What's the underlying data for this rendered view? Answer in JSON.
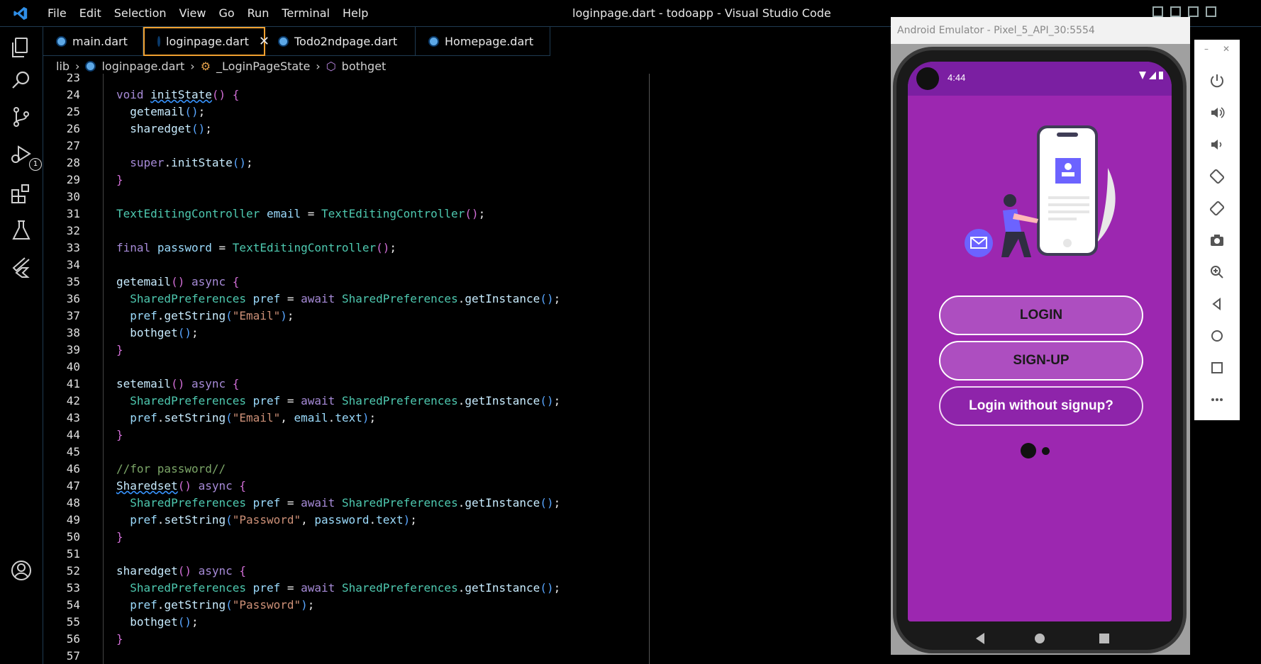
{
  "menu": [
    "File",
    "Edit",
    "Selection",
    "View",
    "Go",
    "Run",
    "Terminal",
    "Help"
  ],
  "window_title": "loginpage.dart - todoapp - Visual Studio Code",
  "tabs": [
    {
      "label": "main.dart"
    },
    {
      "label": "loginpage.dart",
      "active": true
    },
    {
      "label": "Todo2ndpage.dart"
    },
    {
      "label": "Homepage.dart"
    }
  ],
  "breadcrumb": {
    "root": "lib",
    "file": "loginpage.dart",
    "class": "_LoginPageState",
    "method": "bothget"
  },
  "debug_badge": "1",
  "code_lines": [
    {
      "n": "23",
      "html": ""
    },
    {
      "n": "24",
      "html": "<span class='kw'>void</span> <span class='fn squig'>initState</span><span class='br'>()</span> <span class='br'>{</span>"
    },
    {
      "n": "25",
      "html": "  <span class='fn'>getemail</span><span class='br2'>()</span><span class='pn'>;</span>"
    },
    {
      "n": "26",
      "html": "  <span class='fn'>sharedget</span><span class='br2'>()</span><span class='pn'>;</span>"
    },
    {
      "n": "27",
      "html": ""
    },
    {
      "n": "28",
      "html": "  <span class='kw'>super</span><span class='pn'>.</span><span class='fn'>initState</span><span class='br2'>()</span><span class='pn'>;</span>"
    },
    {
      "n": "29",
      "html": "<span class='br'>}</span>"
    },
    {
      "n": "30",
      "html": ""
    },
    {
      "n": "31",
      "html": "<span class='ty'>TextEditingController</span> <span class='var'>email</span> <span class='pn'>=</span> <span class='ty'>TextEditingController</span><span class='br'>()</span><span class='pn'>;</span>"
    },
    {
      "n": "32",
      "html": ""
    },
    {
      "n": "33",
      "html": "<span class='kw'>final</span> <span class='var'>password</span> <span class='pn'>=</span> <span class='ty'>TextEditingController</span><span class='br'>()</span><span class='pn'>;</span>"
    },
    {
      "n": "34",
      "html": ""
    },
    {
      "n": "35",
      "html": "<span class='fn'>getemail</span><span class='br'>()</span> <span class='kw'>async</span> <span class='br'>{</span>"
    },
    {
      "n": "36",
      "html": "  <span class='ty'>SharedPreferences</span> <span class='var'>pref</span> <span class='pn'>=</span> <span class='kw'>await</span> <span class='ty'>SharedPreferences</span><span class='pn'>.</span><span class='fn'>getInstance</span><span class='br2'>()</span><span class='pn'>;</span>"
    },
    {
      "n": "37",
      "html": "  <span class='var'>pref</span><span class='pn'>.</span><span class='fn'>getString</span><span class='br2'>(</span><span class='str'>\"Email\"</span><span class='br2'>)</span><span class='pn'>;</span>"
    },
    {
      "n": "38",
      "html": "  <span class='fn'>bothget</span><span class='br2'>()</span><span class='pn'>;</span>"
    },
    {
      "n": "39",
      "html": "<span class='br'>}</span>"
    },
    {
      "n": "40",
      "html": ""
    },
    {
      "n": "41",
      "html": "<span class='fn'>setemail</span><span class='br'>()</span> <span class='kw'>async</span> <span class='br'>{</span>"
    },
    {
      "n": "42",
      "html": "  <span class='ty'>SharedPreferences</span> <span class='var'>pref</span> <span class='pn'>=</span> <span class='kw'>await</span> <span class='ty'>SharedPreferences</span><span class='pn'>.</span><span class='fn'>getInstance</span><span class='br2'>()</span><span class='pn'>;</span>"
    },
    {
      "n": "43",
      "html": "  <span class='var'>pref</span><span class='pn'>.</span><span class='fn'>setString</span><span class='br2'>(</span><span class='str'>\"Email\"</span><span class='pn'>,</span> <span class='var'>email</span><span class='pn'>.</span><span class='var'>text</span><span class='br2'>)</span><span class='pn'>;</span>"
    },
    {
      "n": "44",
      "html": "<span class='br'>}</span>"
    },
    {
      "n": "45",
      "html": ""
    },
    {
      "n": "46",
      "html": "<span class='cm'>//for password//</span>"
    },
    {
      "n": "47",
      "html": "<span class='fn squig'>Sharedset</span><span class='br'>()</span> <span class='kw'>async</span> <span class='br'>{</span>"
    },
    {
      "n": "48",
      "html": "  <span class='ty'>SharedPreferences</span> <span class='var'>pref</span> <span class='pn'>=</span> <span class='kw'>await</span> <span class='ty'>SharedPreferences</span><span class='pn'>.</span><span class='fn'>getInstance</span><span class='br2'>()</span><span class='pn'>;</span>"
    },
    {
      "n": "49",
      "html": "  <span class='var'>pref</span><span class='pn'>.</span><span class='fn'>setString</span><span class='br2'>(</span><span class='str'>\"Password\"</span><span class='pn'>,</span> <span class='var'>password</span><span class='pn'>.</span><span class='var'>text</span><span class='br2'>)</span><span class='pn'>;</span>"
    },
    {
      "n": "50",
      "html": "<span class='br'>}</span>"
    },
    {
      "n": "51",
      "html": ""
    },
    {
      "n": "52",
      "html": "<span class='fn'>sharedget</span><span class='br'>()</span> <span class='kw'>async</span> <span class='br'>{</span>"
    },
    {
      "n": "53",
      "html": "  <span class='ty'>SharedPreferences</span> <span class='var'>pref</span> <span class='pn'>=</span> <span class='kw'>await</span> <span class='ty'>SharedPreferences</span><span class='pn'>.</span><span class='fn'>getInstance</span><span class='br2'>()</span><span class='pn'>;</span>"
    },
    {
      "n": "54",
      "html": "  <span class='var'>pref</span><span class='pn'>.</span><span class='fn'>getString</span><span class='br2'>(</span><span class='str'>\"Password\"</span><span class='br2'>)</span><span class='pn'>;</span>"
    },
    {
      "n": "55",
      "html": "  <span class='fn'>bothget</span><span class='br2'>()</span><span class='pn'>;</span>"
    },
    {
      "n": "56",
      "html": "<span class='br'>}</span>"
    },
    {
      "n": "57",
      "html": ""
    }
  ],
  "emulator": {
    "title": "Android Emulator - Pixel_5_API_30:5554",
    "time": "4:44",
    "buttons": [
      "LOGIN",
      "SIGN-UP",
      "Login without signup?"
    ],
    "screen_color": "#9c27b0"
  }
}
